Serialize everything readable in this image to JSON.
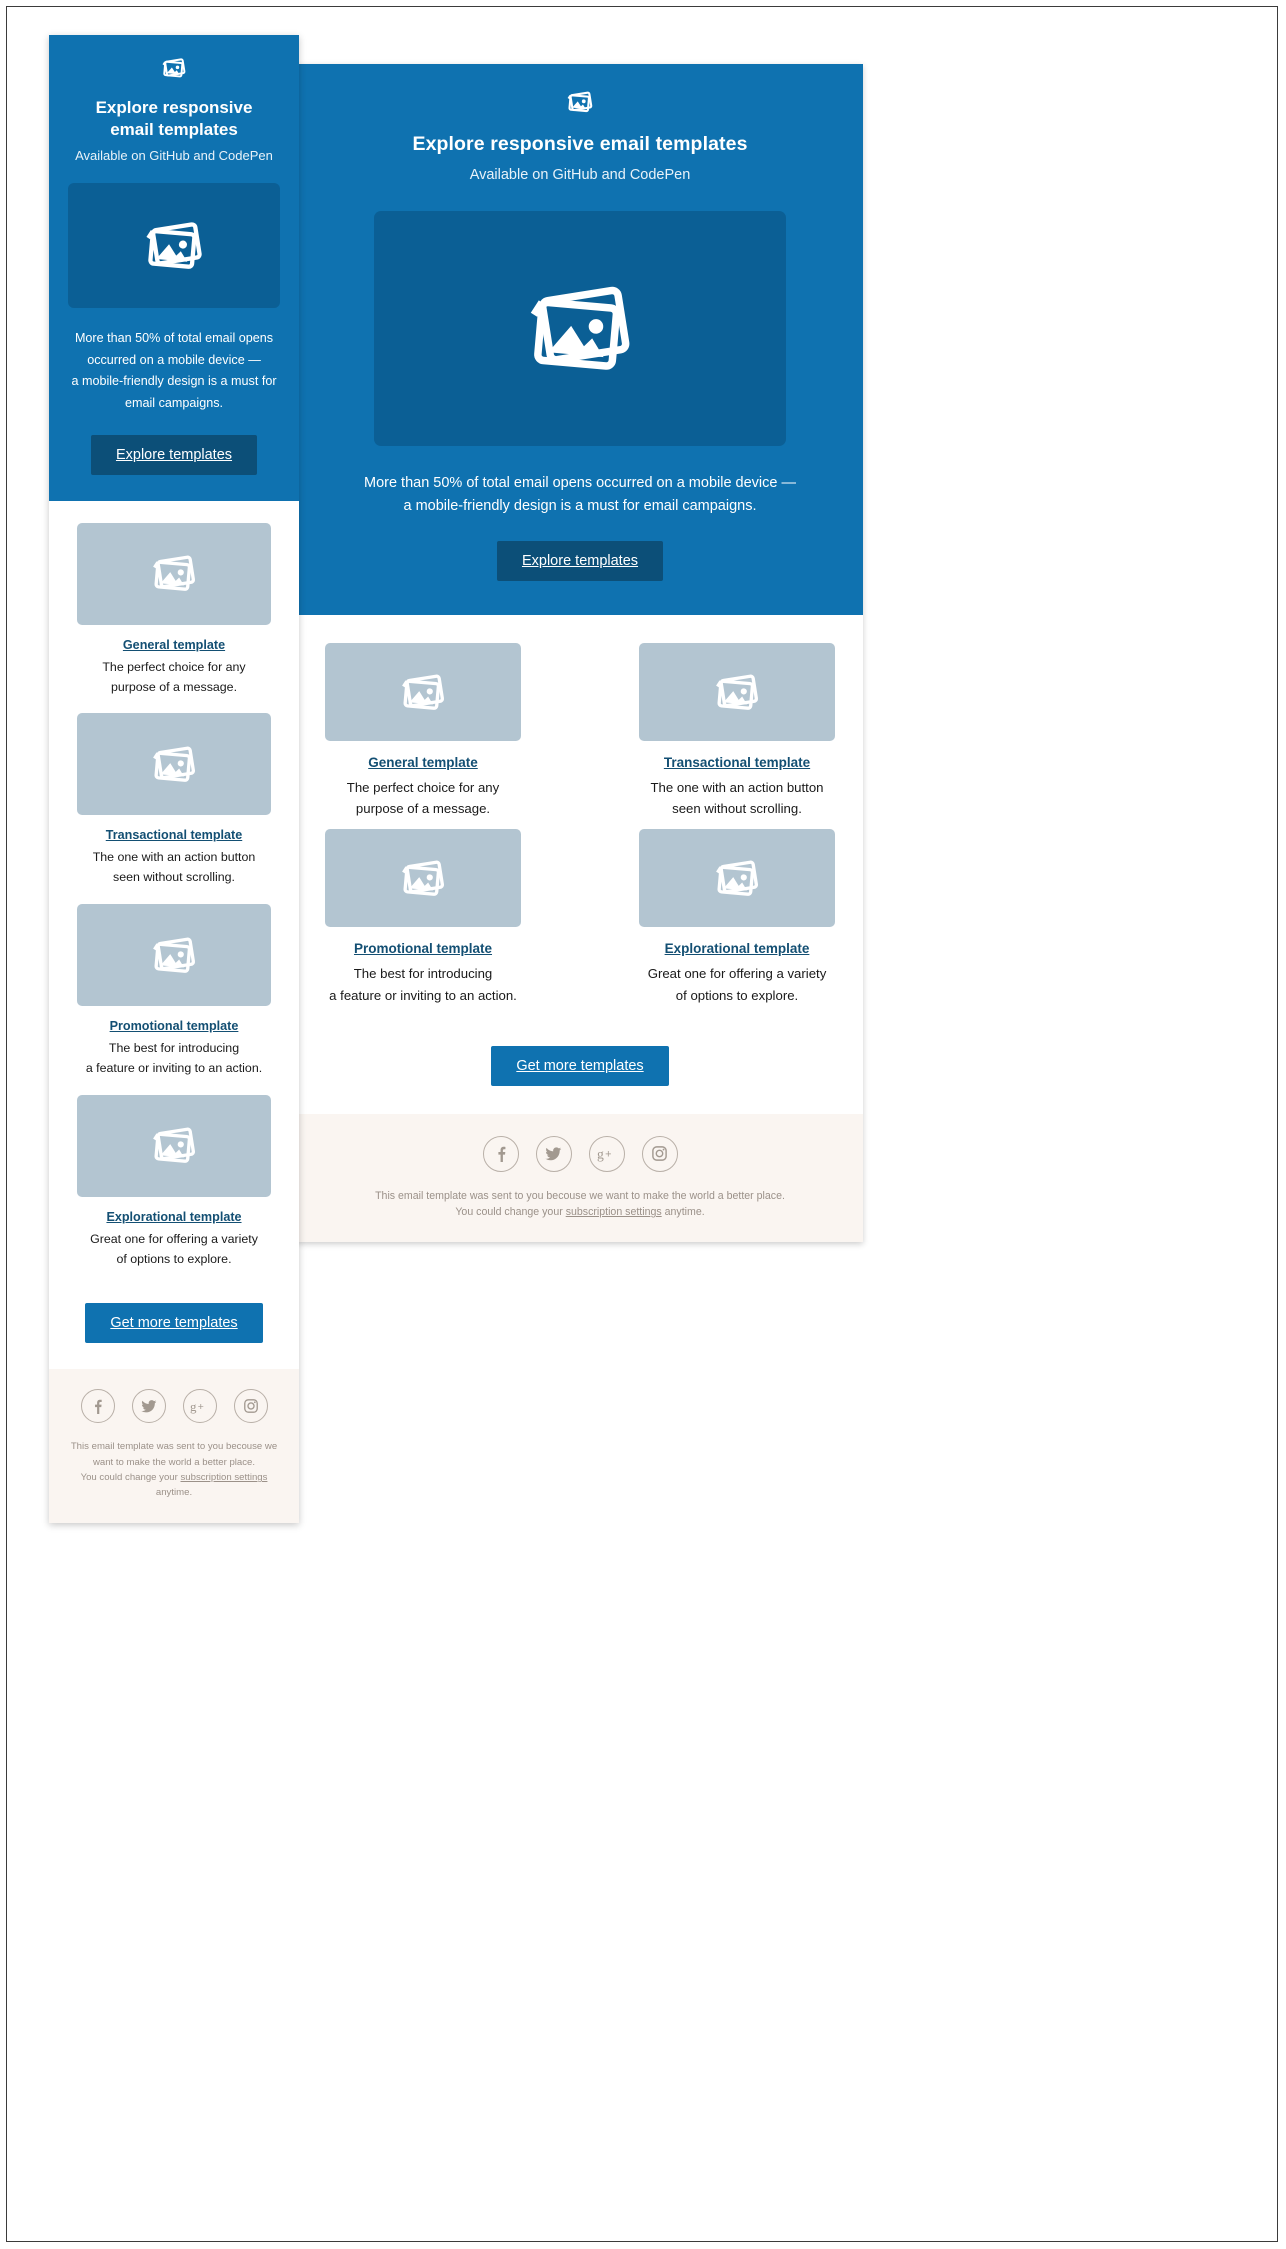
{
  "theme": {
    "brand_blue": "#0f72b0",
    "deep_blue": "#0b5f95",
    "button_dark_blue": "#0c4f78",
    "link_blue": "#134f73",
    "thumb_gray": "#b3c5d1",
    "footer_bg": "#faf5f1",
    "footer_text": "#9b9189",
    "body_text": "#1a1a1a",
    "white": "#ffffff"
  },
  "email": {
    "hero": {
      "logo_icon": "image-placeholder-icon",
      "title": "Explore responsive email templates",
      "title_mobile_line1": "Explore responsive",
      "title_mobile_line2": "email templates",
      "subtitle": "Available on GitHub and CodePen",
      "hero_image_icon": "image-placeholder-icon",
      "body": "More than 50% of total email opens occurred on a mobile device — a mobile-friendly design is a must for email campaigns.",
      "body_desktop_line1": "More than 50% of total email opens occurred on a mobile device —",
      "body_desktop_line2": "a mobile-friendly design is a must for email campaigns.",
      "body_mobile_line1": "More than 50% of total email opens",
      "body_mobile_line2": "occurred on a mobile device —",
      "body_mobile_line3": "a mobile-friendly design is a must for",
      "body_mobile_line4": "email campaigns.",
      "cta_label": "Explore templates"
    },
    "templates": [
      {
        "thumb_icon": "image-placeholder-icon",
        "title": "General template",
        "desc_line1": "The perfect choice for any",
        "desc_line2": "purpose of a message."
      },
      {
        "thumb_icon": "image-placeholder-icon",
        "title": "Transactional template",
        "desc_line1": "The one with an action button",
        "desc_line2": "seen without scrolling."
      },
      {
        "thumb_icon": "image-placeholder-icon",
        "title": "Promotional template",
        "desc_line1": "The best for introducing",
        "desc_line2": "a feature or inviting to an action."
      },
      {
        "thumb_icon": "image-placeholder-icon",
        "title": "Explorational template",
        "desc_line1": "Great one for offering a variety",
        "desc_line2": "of options to explore."
      }
    ],
    "secondary_cta_label": "Get more templates",
    "footer": {
      "social": [
        {
          "name": "facebook-icon",
          "glyph": "f"
        },
        {
          "name": "twitter-icon",
          "glyph": "t"
        },
        {
          "name": "google-plus-icon",
          "glyph": "g+"
        },
        {
          "name": "instagram-icon",
          "glyph": "ig"
        }
      ],
      "note_desktop_line1": "This email template was sent to you becouse we want to make the world a better place.",
      "note_desktop_line2_pre": "You could change your ",
      "note_link": "subscription settings",
      "note_desktop_line2_post": " anytime.",
      "note_mobile_line1": "This email template was sent to you becouse we",
      "note_mobile_line2": "want to make the world a better place.",
      "note_mobile_line3_pre": "You could change your ",
      "note_mobile_line4": "anytime."
    }
  }
}
